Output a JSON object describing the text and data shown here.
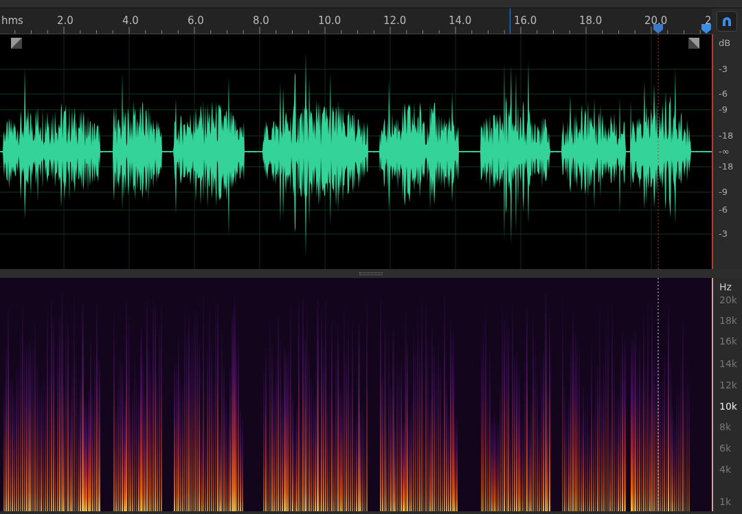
{
  "ruler": {
    "unit": "hms",
    "labels": [
      "2.0",
      "4.0",
      "6.0",
      "8.0",
      "10.0",
      "12.0",
      "14.0",
      "16.0",
      "18.0",
      "20.0",
      "2"
    ]
  },
  "waveform": {
    "unit": "dB",
    "scale": [
      "-3",
      "-6",
      "-9",
      "-18",
      "-∞",
      "-18",
      "-9",
      "-6",
      "-3"
    ]
  },
  "spectrogram": {
    "unit": "Hz",
    "scale": [
      {
        "label": "20k",
        "highlighted": false
      },
      {
        "label": "18k",
        "highlighted": false
      },
      {
        "label": "16k",
        "highlighted": false
      },
      {
        "label": "14k",
        "highlighted": false
      },
      {
        "label": "12k",
        "highlighted": false
      },
      {
        "label": "10k",
        "highlighted": true
      },
      {
        "label": "8k",
        "highlighted": false
      },
      {
        "label": "6k",
        "highlighted": false
      },
      {
        "label": "4k",
        "highlighted": false
      },
      {
        "label": "1k",
        "highlighted": false
      }
    ]
  }
}
